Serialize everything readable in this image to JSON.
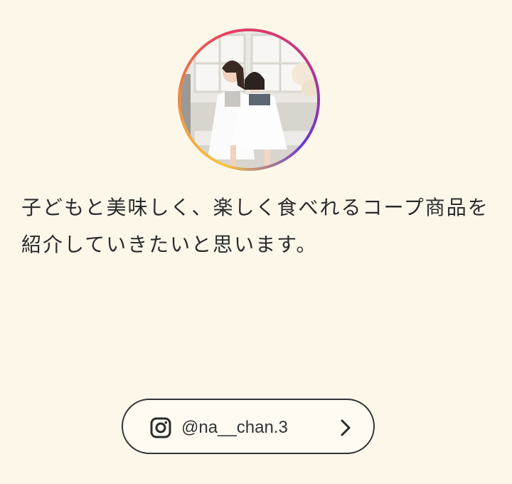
{
  "profile": {
    "avatar_icon": "profile-photo",
    "bio": "子どもと美味しく、楽しく食べれるコープ商品を紹介していきたいと思います。"
  },
  "instagram_link": {
    "icon": "instagram-icon",
    "handle": "@na__chan.3",
    "chevron_icon": "chevron-right-icon"
  },
  "colors": {
    "background": "#fdf7ea",
    "button_border": "#333333",
    "ring_gradient": [
      "#6a34d6",
      "#c13584",
      "#e4405f",
      "#f08a3c",
      "#f4c542"
    ]
  }
}
